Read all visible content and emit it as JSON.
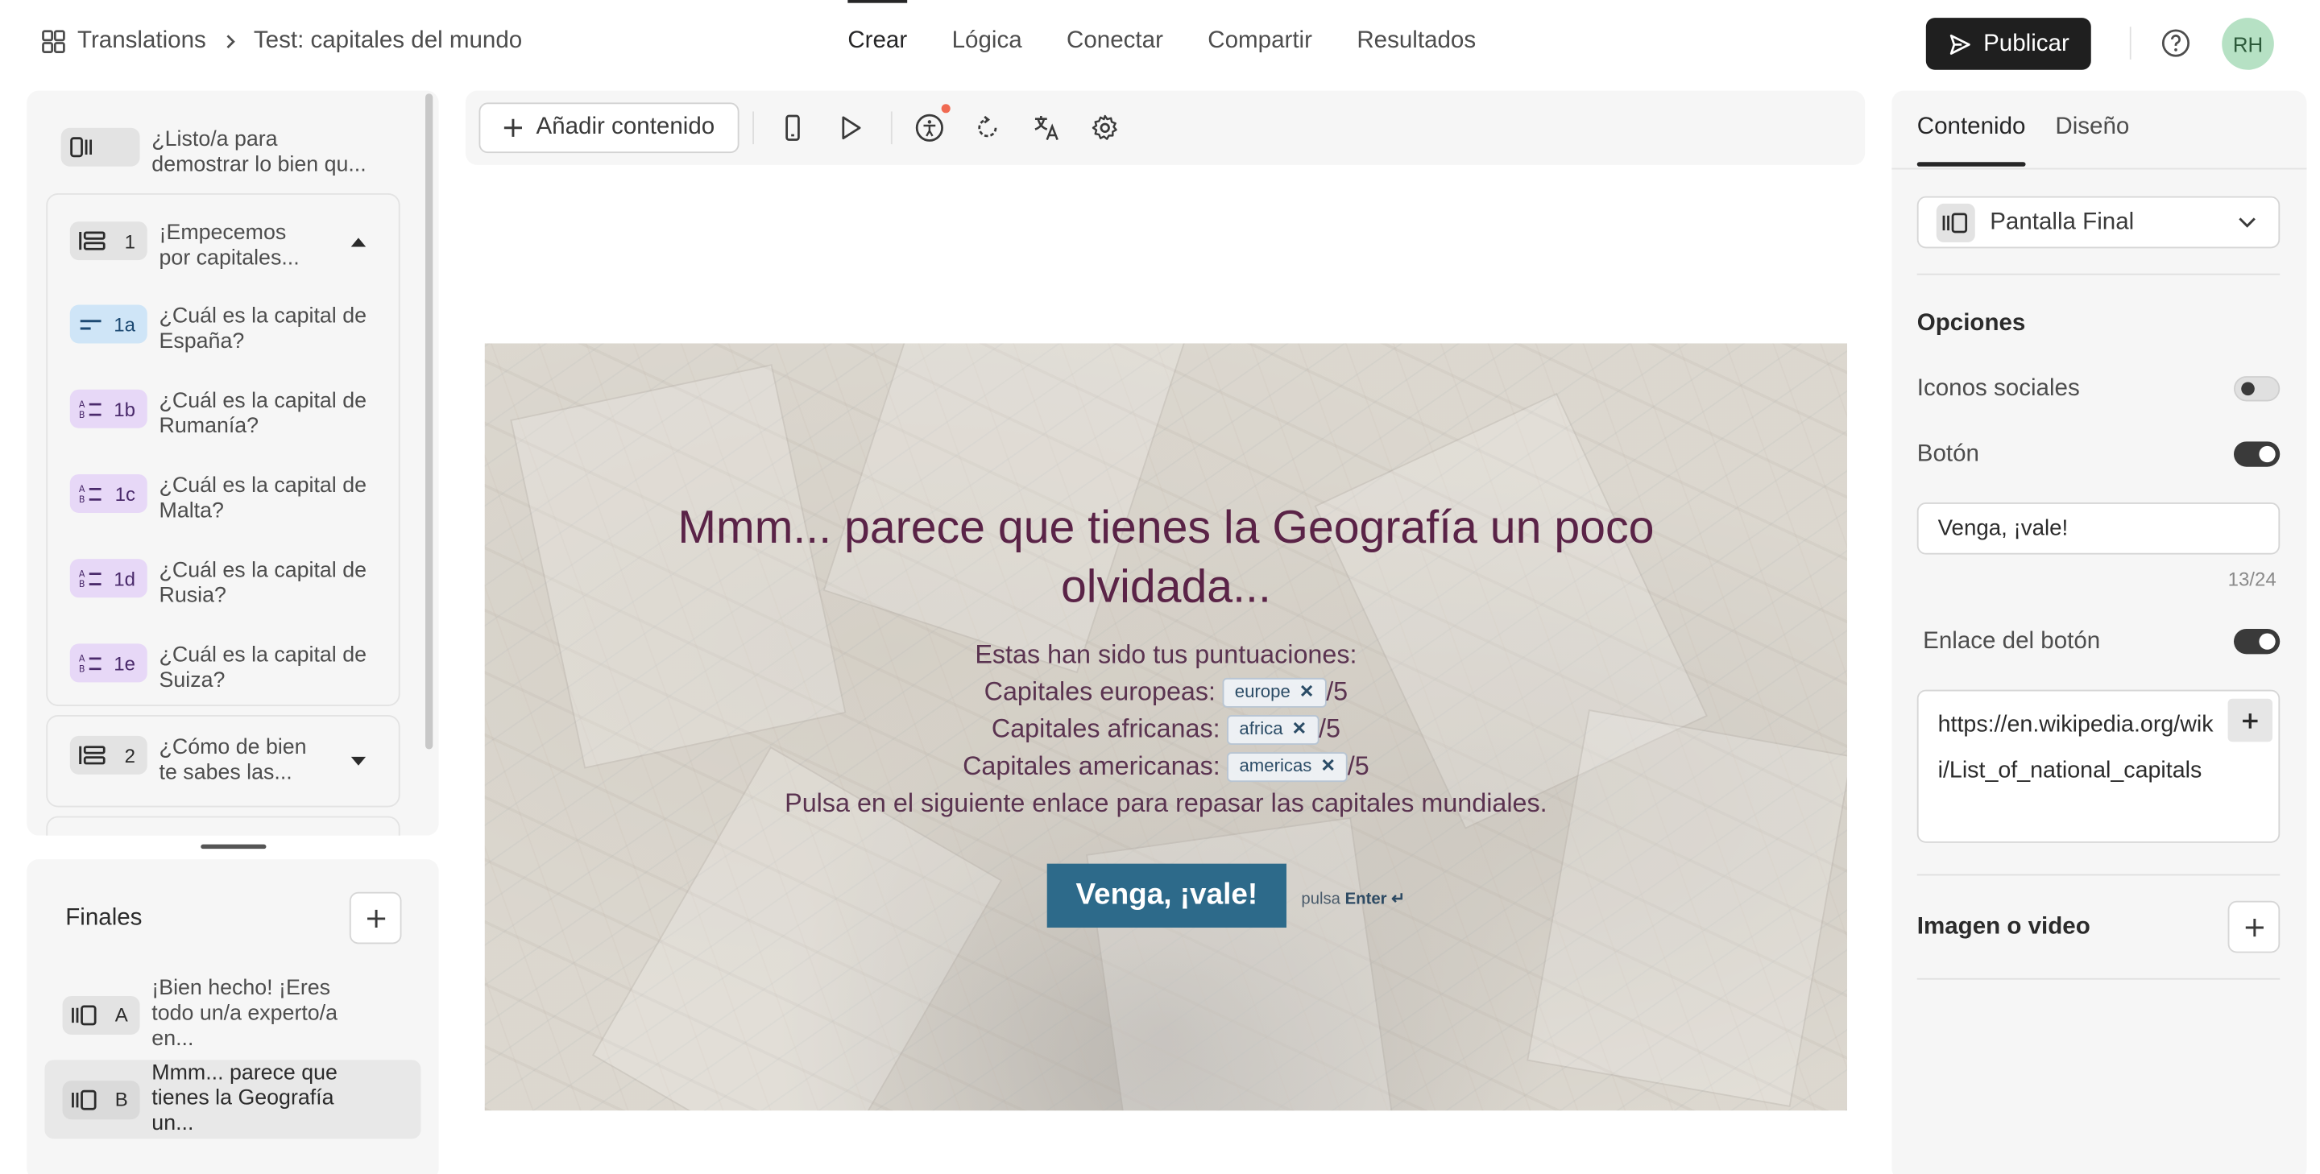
{
  "topbar": {
    "breadcrumb_root": "Translations",
    "breadcrumb_page": "Test: capitales del mundo",
    "nav_tabs": [
      "Crear",
      "Lógica",
      "Conectar",
      "Compartir",
      "Resultados"
    ],
    "active_tab": "Crear",
    "publish_label": "Publicar",
    "avatar_initials": "RH",
    "accent_avatar_color": "#b6e1c4"
  },
  "sidebar": {
    "welcome": {
      "text": "¿Listo/a para demostrar lo bien qu..."
    },
    "group1": {
      "number": "1",
      "text": "¡Empecemos por capitales...",
      "items": [
        {
          "badge": "1a",
          "text": "¿Cuál es la capital de España?",
          "icon": "short-text-icon",
          "color": "#cfe5f7"
        },
        {
          "badge": "1b",
          "text": "¿Cuál es la capital de Rumanía?",
          "icon": "multiple-choice-icon",
          "color": "#e7d8f7"
        },
        {
          "badge": "1c",
          "text": "¿Cuál es la capital de Malta?",
          "icon": "multiple-choice-icon",
          "color": "#e7d8f7"
        },
        {
          "badge": "1d",
          "text": "¿Cuál es la capital de Rusia?",
          "icon": "multiple-choice-icon",
          "color": "#e7d8f7"
        },
        {
          "badge": "1e",
          "text": "¿Cuál es la capital de Suiza?",
          "icon": "multiple-choice-icon",
          "color": "#e7d8f7"
        }
      ]
    },
    "group2": {
      "number": "2",
      "text": "¿Cómo de bien te sabes las..."
    }
  },
  "endings": {
    "title": "Finales",
    "items": [
      {
        "badge": "A",
        "text": "¡Bien hecho! ¡Eres todo un/a experto/a en..."
      },
      {
        "badge": "B",
        "text": "Mmm... parece que tienes la Geografía un..."
      }
    ]
  },
  "toolbar": {
    "add_content_label": "Añadir contenido",
    "icons": [
      "mobile-preview-icon",
      "play-icon",
      "accessibility-icon",
      "reload-icon",
      "translate-icon",
      "settings-icon"
    ]
  },
  "preview": {
    "title": "Mmm... parece que tienes la Geografía un poco olvidada...",
    "line1": "Estas han sido tus puntuaciones:",
    "europe_label": "Capitales europeas:",
    "europe_chip": "europe",
    "africa_label": "Capitales africanas:",
    "africa_chip": "africa",
    "americas_label": "Capitales americanas:",
    "americas_chip": "americas",
    "suffix": "/5",
    "last_line": "Pulsa en el siguiente enlace para repasar las capitales mundiales.",
    "button_label": "Venga, ¡vale!",
    "hint_prefix": "pulsa",
    "hint_key": "Enter ↵",
    "button_color": "#2d6a8a",
    "title_color": "#5a2347"
  },
  "right": {
    "tab_content": "Contenido",
    "tab_design": "Diseño",
    "screen_type": "Pantalla Final",
    "options_heading": "Opciones",
    "social_icons_label": "Iconos sociales",
    "social_icons_on": false,
    "button_label": "Botón",
    "button_on": true,
    "button_text_value": "Venga, ¡vale!",
    "counter": "13/24",
    "button_link_label": "Enlace del botón",
    "button_link_on": true,
    "url_value": "https://en.wikipedia.org/wiki/List_of_national_capitals",
    "media_label": "Imagen o video"
  }
}
